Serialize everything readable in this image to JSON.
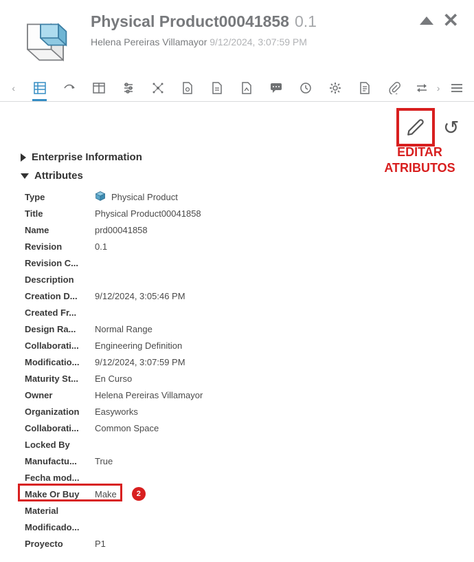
{
  "header": {
    "title": "Physical Product00041858",
    "revision": "0.1",
    "owner": "Helena Pereiras Villamayor",
    "timestamp": "9/12/2024, 3:07:59 PM"
  },
  "annotations": {
    "edit_label": "EDITAR ATRIBUTOS",
    "badge_number": "2"
  },
  "sections": {
    "enterprise": {
      "label": "Enterprise Information",
      "expanded": false
    },
    "attributes": {
      "label": "Attributes",
      "expanded": true
    }
  },
  "attributes": [
    {
      "key": "Type",
      "value": "Physical Product",
      "icon": "cube"
    },
    {
      "key": "Title",
      "value": "Physical Product00041858"
    },
    {
      "key": "Name",
      "value": "prd00041858"
    },
    {
      "key": "Revision",
      "value": "0.1"
    },
    {
      "key": "Revision C...",
      "value": ""
    },
    {
      "key": "Description",
      "value": ""
    },
    {
      "key": "Creation D...",
      "value": "9/12/2024, 3:05:46 PM"
    },
    {
      "key": "Created Fr...",
      "value": ""
    },
    {
      "key": "Design Ra...",
      "value": "Normal Range"
    },
    {
      "key": "Collaborati...",
      "value": "Engineering Definition"
    },
    {
      "key": "Modificatio...",
      "value": "9/12/2024, 3:07:59 PM"
    },
    {
      "key": "Maturity St...",
      "value": "En Curso"
    },
    {
      "key": "Owner",
      "value": "Helena Pereiras Villamayor"
    },
    {
      "key": "Organization",
      "value": "Easyworks"
    },
    {
      "key": "Collaborati...",
      "value": "Common Space"
    },
    {
      "key": "Locked By",
      "value": ""
    },
    {
      "key": "Manufactu...",
      "value": "True"
    },
    {
      "key": "Fecha mod...",
      "value": ""
    },
    {
      "key": "Make Or Buy",
      "value": "Make",
      "highlight": true,
      "badge": true
    },
    {
      "key": "Material",
      "value": ""
    },
    {
      "key": "Modificado...",
      "value": ""
    },
    {
      "key": "Proyecto",
      "value": "P1"
    }
  ]
}
